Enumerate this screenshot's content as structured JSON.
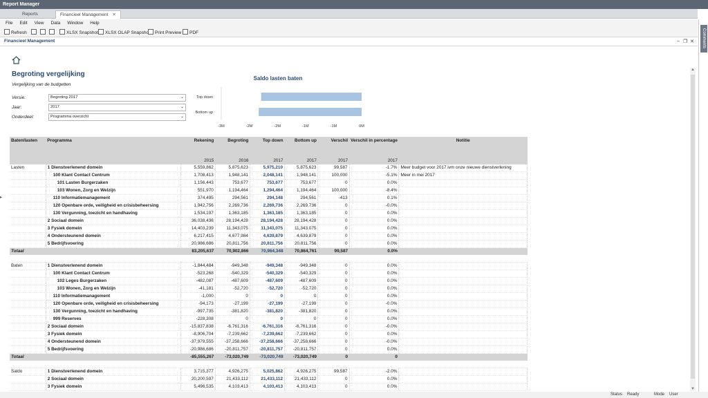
{
  "app": {
    "title": "Report Manager"
  },
  "tabs": [
    {
      "label": "Reports"
    },
    {
      "label": "Financieel Management"
    }
  ],
  "menu": [
    "File",
    "Edit",
    "View",
    "Data",
    "Window",
    "Help"
  ],
  "toolbar": {
    "refresh": "Refresh",
    "xlsx": "XLSX Snapshot",
    "olap": "XLSX OLAP Snapshot",
    "print": "Print Preview",
    "pdf": "PDF"
  },
  "document": {
    "title": "Financieel Management"
  },
  "side": {
    "label": "Comments"
  },
  "report": {
    "title": "Begroting vergelijking",
    "subtitle": "Vergelijking van de budgetten",
    "filters": [
      {
        "label": "Versie:",
        "value": "Begroting 2017"
      },
      {
        "label": "Jaar:",
        "value": "2017"
      },
      {
        "label": "Onderdeel:",
        "value": "Programma overzicht"
      }
    ]
  },
  "chart_data": {
    "type": "bar",
    "title": "Saldo lasten baten",
    "categories": [
      "Top down",
      "Bottom up"
    ],
    "values": [
      -2100000,
      -2150000
    ],
    "xticks": [
      "-3M",
      "-2M",
      "-2M",
      "-1M",
      "-1M",
      "0M"
    ],
    "xlim": [
      -2500000,
      0
    ],
    "orientation": "horizontal",
    "bar_color": "#a9c4e0"
  },
  "table": {
    "headers": [
      "Baten/lasten",
      "Programma",
      "Rekening",
      "Begroting",
      "Top down",
      "Bottom up",
      "Verschil",
      "Verschil in percentage",
      "Notitie"
    ],
    "years": [
      "",
      "",
      "2015",
      "2016",
      "2017",
      "2017",
      "2017",
      "2017",
      ""
    ],
    "lasten": {
      "group": "Lasten",
      "rows": [
        {
          "p": "1 Dienstverlenend domein",
          "lvl": 0,
          "r": "5,559,862",
          "b": "5,875,623",
          "t": "5,975,210",
          "bu": "5,875,623",
          "v": "99,587",
          "pc": "-1.7%",
          "n": "Meer budget voor 2017 ivm onze nieuwe dienstverlening"
        },
        {
          "p": "100 Klant Contact Centrum",
          "lvl": 1,
          "r": "1,708,413",
          "b": "1,948,141",
          "t": "2,048,141",
          "bu": "1,948,141",
          "v": "100,000",
          "pc": "-5.1%",
          "n": "Meer in mei 2017"
        },
        {
          "p": "101 Lasten Burgerzaken",
          "lvl": 2,
          "r": "1,156,443",
          "b": "753,677",
          "t": "753,677",
          "bu": "753,677",
          "v": "0",
          "pc": "0.0%",
          "n": ""
        },
        {
          "p": "103 Wonen, Zorg en Welzijn",
          "lvl": 2,
          "r": "551,970",
          "b": "1,194,464",
          "t": "1,294,464",
          "bu": "1,194,464",
          "v": "100,000",
          "pc": "-8.4%",
          "n": ""
        },
        {
          "p": "110 Informatiemanagement",
          "lvl": 1,
          "r": "374,495",
          "b": "294,561",
          "t": "294,148",
          "bu": "294,561",
          "v": "-413",
          "pc": "0.1%",
          "n": ""
        },
        {
          "p": "120 Openbare orde, veiligheid en crisisbeheersing",
          "lvl": 1,
          "r": "1,942,756",
          "b": "2,269,736",
          "t": "2,269,736",
          "bu": "2,269,736",
          "v": "0",
          "pc": "-0.0%",
          "n": ""
        },
        {
          "p": "130 Vergunning, toezicht en handhaving",
          "lvl": 1,
          "r": "1,534,197",
          "b": "1,363,185",
          "t": "1,363,185",
          "bu": "1,363,185",
          "v": "0",
          "pc": "0.0%",
          "n": ""
        },
        {
          "p": "2 Sociaal domein",
          "lvl": 0,
          "r": "36,038,436",
          "b": "28,194,428",
          "t": "28,194,428",
          "bu": "28,194,428",
          "v": "0",
          "pc": "0.0%",
          "n": ""
        },
        {
          "p": "3 Fysiek domein",
          "lvl": 0,
          "r": "14,403,239",
          "b": "11,343,075",
          "t": "11,343,075",
          "bu": "11,343,075",
          "v": "0",
          "pc": "0.0%",
          "n": ""
        },
        {
          "p": "4 Ondersteunend domein",
          "lvl": 0,
          "r": "6,217,415",
          "b": "4,677,984",
          "t": "4,639,879",
          "bu": "4,639,879",
          "v": "0",
          "pc": "0.0%",
          "n": ""
        },
        {
          "p": "5 Bedrijfsvoering",
          "lvl": 0,
          "r": "20,986,686",
          "b": "20,811,756",
          "t": "20,811,756",
          "bu": "20,811,756",
          "v": "0",
          "pc": "0.0%",
          "n": ""
        }
      ],
      "total": {
        "label": "Totaal",
        "r": "83,205,637",
        "b": "70,902,866",
        "t": "70,964,348",
        "bu": "70,864,761",
        "v": "99,587",
        "pc": "0.0%"
      }
    },
    "baten": {
      "group": "Baten",
      "rows": [
        {
          "p": "1 Dienstverlenend domein",
          "lvl": 0,
          "r": "-1,844,484",
          "b": "-949,348",
          "t": "-949,348",
          "bu": "-949,348",
          "v": "0",
          "pc": "0.0%",
          "n": ""
        },
        {
          "p": "100 Klant Contact Centrum",
          "lvl": 1,
          "r": "-523,268",
          "b": "-540,329",
          "t": "-540,329",
          "bu": "-540,329",
          "v": "0",
          "pc": "0.0%",
          "n": ""
        },
        {
          "p": "102 Leges Burgerzaken",
          "lvl": 2,
          "r": "-482,087",
          "b": "-487,609",
          "t": "-487,609",
          "bu": "-487,609",
          "v": "0",
          "pc": "0.0%",
          "n": ""
        },
        {
          "p": "103 Wonen, Zorg en Welzijn",
          "lvl": 2,
          "r": "-41,181",
          "b": "-52,720",
          "t": "-52,720",
          "bu": "-52,720",
          "v": "0",
          "pc": "0.0%",
          "n": ""
        },
        {
          "p": "110 Informatiemanagement",
          "lvl": 1,
          "r": "-1,000",
          "b": "0",
          "t": "0",
          "bu": "0",
          "v": "0",
          "pc": "0.0%",
          "n": ""
        },
        {
          "p": "120 Openbare orde, veiligheid en crisisbeheersing",
          "lvl": 1,
          "r": "-94,173",
          "b": "-27,199",
          "t": "-27,199",
          "bu": "-27,199",
          "v": "0",
          "pc": "-0.0%",
          "n": ""
        },
        {
          "p": "130 Vergunning, toezicht en handhaving",
          "lvl": 1,
          "r": "-997,735",
          "b": "-381,820",
          "t": "-381,820",
          "bu": "-381,820",
          "v": "0",
          "pc": "0.0%",
          "n": ""
        },
        {
          "p": "999 Reserves",
          "lvl": 1,
          "r": "-228,308",
          "b": "0",
          "t": "0",
          "bu": "0",
          "v": "0",
          "pc": "0.0%",
          "n": ""
        },
        {
          "p": "2 Sociaal domein",
          "lvl": 0,
          "r": "-15,837,838",
          "b": "-6,761,316",
          "t": "-6,761,316",
          "bu": "-6,761,316",
          "v": "0",
          "pc": "-0.0%",
          "n": ""
        },
        {
          "p": "3 Fysiek domein",
          "lvl": 0,
          "r": "-8,906,704",
          "b": "-7,239,662",
          "t": "-7,239,662",
          "bu": "-7,239,662",
          "v": "0",
          "pc": "0.0%",
          "n": ""
        },
        {
          "p": "4 Ondersteunend domein",
          "lvl": 0,
          "r": "-37,979,555",
          "b": "-37,258,666",
          "t": "-37,258,666",
          "bu": "-37,258,666",
          "v": "0",
          "pc": "-0.0%",
          "n": ""
        },
        {
          "p": "5 Bedrijfsvoering",
          "lvl": 0,
          "r": "-20,986,686",
          "b": "-20,811,757",
          "t": "-20,811,757",
          "bu": "-20,811,757",
          "v": "0",
          "pc": "0.0%",
          "n": ""
        }
      ],
      "total": {
        "label": "Totaal",
        "r": "-85,555,267",
        "b": "-73,020,749",
        "t": "-73,020,749",
        "bu": "-73,020,749",
        "v": "0",
        "pc": "0"
      }
    },
    "saldo": {
      "group": "Saldo",
      "rows": [
        {
          "p": "1 Dienstverlenend domein",
          "lvl": 0,
          "r": "3,715,377",
          "b": "4,926,275",
          "t": "5,025,862",
          "bu": "4,926,275",
          "v": "99,587",
          "pc": "-2.0%",
          "n": ""
        },
        {
          "p": "2 Sociaal domein",
          "lvl": 0,
          "r": "20,200,597",
          "b": "21,433,112",
          "t": "21,433,112",
          "bu": "21,433,112",
          "v": "0",
          "pc": "0.0%",
          "n": ""
        },
        {
          "p": "3 Fysiek domein",
          "lvl": 0,
          "r": "5,496,535",
          "b": "4,103,413",
          "t": "4,103,413",
          "bu": "4,103,413",
          "v": "0",
          "pc": "0.0%",
          "n": ""
        }
      ]
    }
  },
  "status": {
    "status_label": "Status",
    "status_value": "Ready",
    "mode_label": "Mode",
    "mode_value": "User"
  }
}
